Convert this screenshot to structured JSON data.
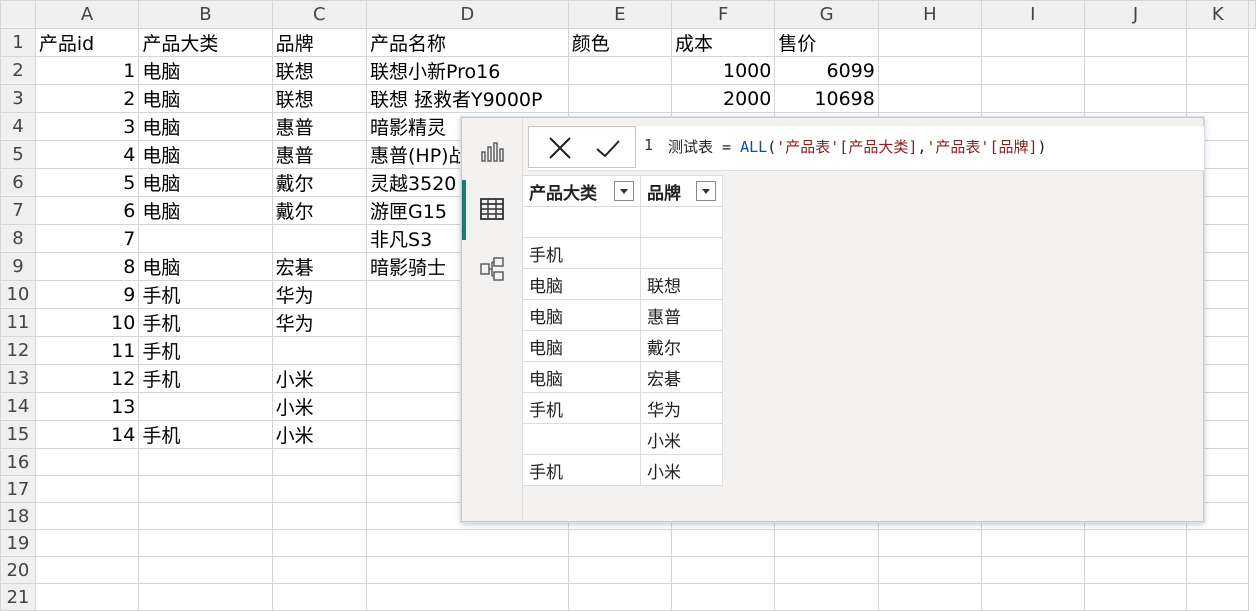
{
  "sheet": {
    "columns": [
      "A",
      "B",
      "C",
      "D",
      "E",
      "F",
      "G",
      "H",
      "I",
      "J",
      "K"
    ],
    "rows": [
      [
        "产品id",
        "产品大类",
        "品牌",
        "产品名称",
        "颜色",
        "成本",
        "售价"
      ],
      [
        "1",
        "电脑",
        "联想",
        "联想小新Pro16",
        "",
        "1000",
        "6099"
      ],
      [
        "2",
        "电脑",
        "联想",
        "联想 拯救者Y9000P",
        "",
        "2000",
        "10698"
      ],
      [
        "3",
        "电脑",
        "惠普",
        "暗影精灵",
        "",
        "",
        "",
        ""
      ],
      [
        "4",
        "电脑",
        "惠普",
        "惠普(HP)战",
        "",
        "",
        ""
      ],
      [
        "5",
        "电脑",
        "戴尔",
        "灵越3520",
        "",
        "",
        ""
      ],
      [
        "6",
        "电脑",
        "戴尔",
        "游匣G15",
        "",
        "",
        ""
      ],
      [
        "7",
        "",
        "",
        "非凡S3",
        "",
        "",
        ""
      ],
      [
        "8",
        "电脑",
        "宏碁",
        "暗影骑士",
        "",
        "",
        ""
      ],
      [
        "9",
        "手机",
        "华为",
        "",
        "",
        "",
        ""
      ],
      [
        "10",
        "手机",
        "华为",
        "",
        "",
        "",
        ""
      ],
      [
        "11",
        "手机",
        "",
        "",
        "",
        "",
        ""
      ],
      [
        "12",
        "手机",
        "小米",
        "",
        "",
        "",
        ""
      ],
      [
        "13",
        "",
        "小米",
        "",
        "",
        "",
        ""
      ],
      [
        "14",
        "手机",
        "小米",
        "",
        "",
        "",
        ""
      ],
      [
        "",
        "",
        "",
        "",
        "",
        "",
        ""
      ],
      [
        "",
        "",
        "",
        "",
        "",
        "",
        ""
      ],
      [
        "",
        "",
        "",
        "",
        "",
        "",
        ""
      ],
      [
        "",
        "",
        "",
        "",
        "",
        "",
        ""
      ],
      [
        "",
        "",
        "",
        "",
        "",
        "",
        ""
      ],
      [
        "",
        "",
        "",
        "",
        "",
        "",
        ""
      ]
    ]
  },
  "editor": {
    "rail_icons": [
      "report-view-icon",
      "table-view-icon",
      "model-view-icon"
    ],
    "cancel_icon": "close-icon",
    "commit_icon": "checkmark-icon",
    "line_number": "1",
    "formula": {
      "name": "测试表",
      "op": " = ",
      "func": "ALL",
      "open": "(",
      "arg1": "'产品表'[产品大类]",
      "sep": ",",
      "arg2": "'产品表'[品牌]",
      "close": ")"
    },
    "result": {
      "headers": [
        "产品大类",
        "品牌"
      ],
      "rows": [
        [
          "",
          ""
        ],
        [
          "手机",
          ""
        ],
        [
          "电脑",
          "联想"
        ],
        [
          "电脑",
          "惠普"
        ],
        [
          "电脑",
          "戴尔"
        ],
        [
          "电脑",
          "宏碁"
        ],
        [
          "手机",
          "华为"
        ],
        [
          "",
          "小米"
        ],
        [
          "手机",
          "小米"
        ]
      ]
    }
  }
}
